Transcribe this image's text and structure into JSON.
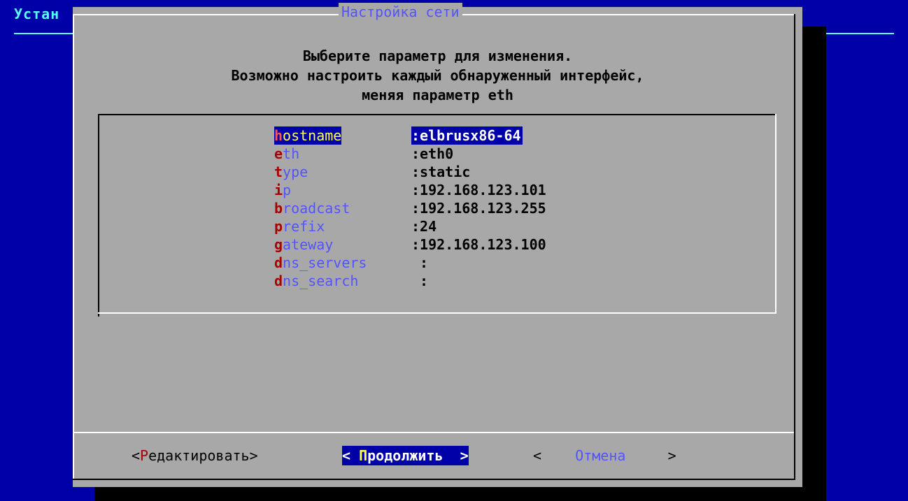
{
  "background": {
    "title": "Устан"
  },
  "dialog": {
    "title": "Настройка сети",
    "prompt": [
      "Выберите параметр для изменения.",
      "Возможно настроить каждый обнаруженный интерфейс,",
      "меняя параметр eth"
    ]
  },
  "fields": [
    {
      "hot": "h",
      "rest": "ostname",
      "value": ":elbrusx86-64",
      "selected": true
    },
    {
      "hot": "e",
      "rest": "th",
      "value": ":eth0"
    },
    {
      "hot": "t",
      "rest": "ype",
      "value": ":static"
    },
    {
      "hot": "i",
      "rest": "p",
      "value": ":192.168.123.101"
    },
    {
      "hot": "b",
      "rest": "roadcast",
      "value": ":192.168.123.255"
    },
    {
      "hot": "p",
      "rest": "refix",
      "value": ":24"
    },
    {
      "hot": "g",
      "rest": "ateway",
      "value": ":192.168.123.100"
    },
    {
      "hot": "d",
      "rest": "ns_servers",
      "value": " :"
    },
    {
      "hot": "d",
      "rest": "ns_search",
      "value": " :"
    }
  ],
  "buttons": {
    "edit": {
      "open": "<",
      "hot": "Р",
      "rest": "едактировать",
      "close": ">"
    },
    "next": {
      "open": "< ",
      "hot": "П",
      "rest": "родолжить",
      "close": "  >"
    },
    "cancel": {
      "open": "<    ",
      "label": "Отмена",
      "close": "     >"
    }
  },
  "colors": {
    "screen_bg": "#0000a8",
    "dialog_bg": "#a8a8a8",
    "title_fg": "#5454ff",
    "hotkey_fg": "#a80000",
    "selected_bg": "#0000a8",
    "selected_key_fg": "#ffff54"
  }
}
